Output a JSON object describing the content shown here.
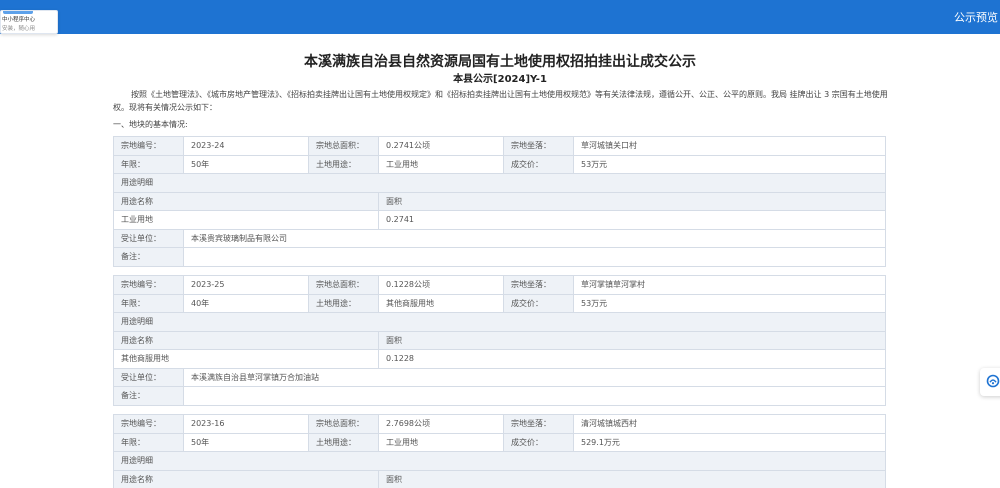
{
  "topbar": {
    "preview_label": "公示预览"
  },
  "mini_popup": {
    "title": "中小程序中心",
    "subtitle": "安装，随心用"
  },
  "announcement": {
    "title": "本溪满族自治县自然资源局国有土地使用权招拍挂出让成交公示",
    "subtitle": "本县公示[2024]Y-1",
    "intro": "按照《土地管理法》、《城市房地产管理法》、《招标拍卖挂牌出让国有土地使用权规定》和《招标拍卖挂牌出让国有土地使用权规范》等有关法律法规，遵循公开、公正、公平的原则。我局 挂牌出让 3 宗国有土地使用权。现将有关情况公示如下：",
    "section_title": "一、地块的基本情况:"
  },
  "labels": {
    "parcel_no": "宗地编号：",
    "total_area": "宗地总面积：",
    "location": "宗地坐落：",
    "term": "年限：",
    "land_use": "土地用途：",
    "deal_price": "成交价：",
    "use_detail": "用途明细",
    "use_name": "用途名称",
    "area": "面积",
    "grantee": "受让单位：",
    "remarks": "备注："
  },
  "parcels": [
    {
      "parcel_no": "2023-24",
      "total_area": "0.2741公顷",
      "location": "草河城镇关口村",
      "term": "50年",
      "land_use": "工业用地",
      "deal_price": "53万元",
      "use_name": "工业用地",
      "use_area": "0.2741",
      "grantee": "本溪贵宾玻璃制品有限公司",
      "remarks": ""
    },
    {
      "parcel_no": "2023-25",
      "total_area": "0.1228公顷",
      "location": "草河掌镇草河掌村",
      "term": "40年",
      "land_use": "其他商服用地",
      "deal_price": "53万元",
      "use_name": "其他商服用地",
      "use_area": "0.1228",
      "grantee": "本溪满族自治县草河掌镇万合加油站",
      "remarks": ""
    },
    {
      "parcel_no": "2023-16",
      "total_area": "2.7698公顷",
      "location": "清河城镇城西村",
      "term": "50年",
      "land_use": "工业用地",
      "deal_price": "529.1万元",
      "use_name": "",
      "use_area": "",
      "grantee": "",
      "remarks": ""
    }
  ]
}
